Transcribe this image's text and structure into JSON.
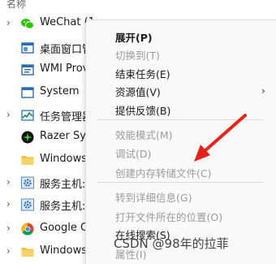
{
  "list_header": "名称",
  "processes": [
    {
      "name": "WeChat (1",
      "expand": true,
      "icon": "wechat-icon"
    },
    {
      "name": "桌面窗口管",
      "expand": false,
      "icon": "window-icon"
    },
    {
      "name": "WMI Prov",
      "expand": false,
      "icon": "wmi-icon"
    },
    {
      "name": "System",
      "expand": false,
      "icon": "system-icon"
    },
    {
      "name": "任务管理器",
      "expand": true,
      "icon": "task-manager-icon"
    },
    {
      "name": "Razer Syn",
      "expand": false,
      "icon": "razer-icon"
    },
    {
      "name": "Windows",
      "expand": false,
      "icon": "folder-icon"
    },
    {
      "name": "服务主机:",
      "expand": true,
      "icon": "gear-icon"
    },
    {
      "name": "服务主机:",
      "expand": true,
      "icon": "gear-icon"
    },
    {
      "name": "Google C",
      "expand": true,
      "icon": "chrome-icon"
    },
    {
      "name": "Windows",
      "expand": true,
      "icon": "folder-icon"
    }
  ],
  "context_menu": {
    "items": [
      {
        "label": "展开(P)",
        "enabled": true,
        "bold": true
      },
      {
        "label": "切换到(T)",
        "enabled": false
      },
      {
        "label": "结束任务(E)",
        "enabled": true
      },
      {
        "label": "资源值(V)",
        "enabled": true,
        "submenu": true
      },
      {
        "label": "提供反馈(B)",
        "enabled": true
      },
      {
        "label": "效能模式(M)",
        "enabled": false
      },
      {
        "label": "调试(D)",
        "enabled": false
      },
      {
        "label": "创建内存转储文件(C)",
        "enabled": false
      },
      {
        "label": "转到详细信息(G)",
        "enabled": false
      },
      {
        "label": "打开文件所在的位置(O)",
        "enabled": false
      },
      {
        "label": "在线搜索(S)",
        "enabled": true
      },
      {
        "label": "属性(I)",
        "enabled": false
      }
    ]
  },
  "watermark": "CSDN @98年的拉菲",
  "colors": {
    "annotation_arrow": "#e8231a",
    "menu_bg": "#f9f9f9",
    "disabled_text": "#9b9b9b"
  }
}
